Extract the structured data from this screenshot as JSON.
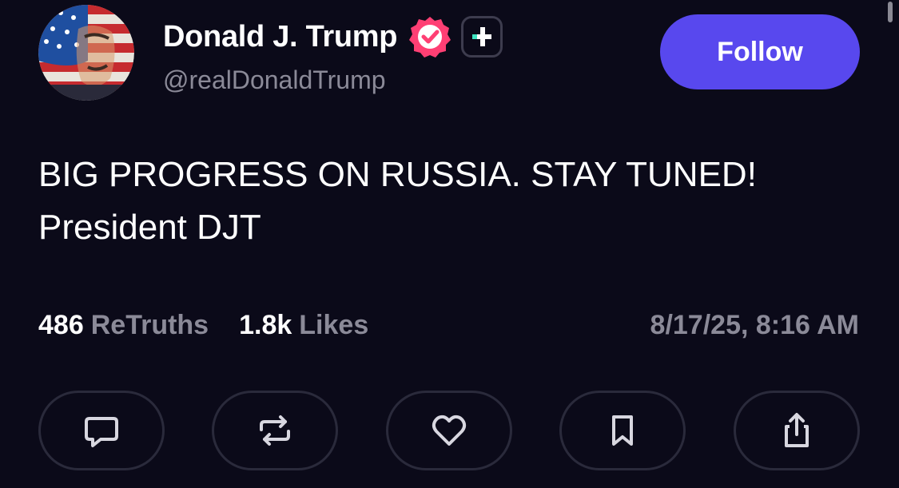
{
  "author": {
    "display_name": "Donald J. Trump",
    "handle": "@realDonaldTrump",
    "verified_icon": "verified-check-badge-icon",
    "plus_icon": "truth-plus-icon"
  },
  "follow": {
    "label": "Follow"
  },
  "post": {
    "lines": [
      "BIG PROGRESS ON RUSSIA. STAY TUNED!",
      "President DJT"
    ]
  },
  "stats": {
    "retruths_count": "486",
    "retruths_label": "ReTruths",
    "likes_count": "1.8k",
    "likes_label": "Likes",
    "timestamp": "8/17/25, 8:16 AM"
  },
  "actions": [
    {
      "name": "reply",
      "icon": "comment-icon"
    },
    {
      "name": "retruth",
      "icon": "retruth-icon"
    },
    {
      "name": "like",
      "icon": "heart-icon"
    },
    {
      "name": "bookmark",
      "icon": "bookmark-icon"
    },
    {
      "name": "share",
      "icon": "share-icon"
    }
  ],
  "colors": {
    "background": "#0b0a19",
    "accent": "#5848ee",
    "verified": "#ff3f74",
    "plus": "#3ee3c0",
    "muted_text": "#8b8a98",
    "button_border": "#2a2a3b"
  }
}
